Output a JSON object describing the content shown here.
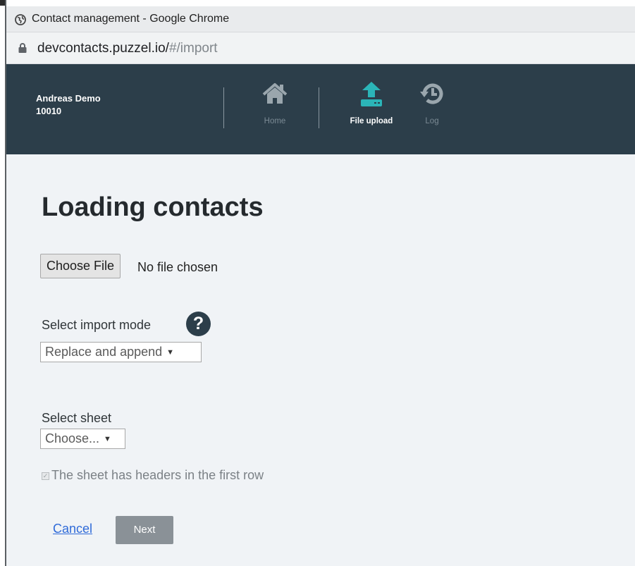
{
  "browser": {
    "window_title": "Contact management - Google Chrome",
    "url_host": "devcontacts.puzzel.io/",
    "url_path": "#/import"
  },
  "header": {
    "user_name": "Andreas Demo",
    "user_id": "10010",
    "nav": [
      {
        "label": "Home",
        "icon": "home-icon",
        "active": false
      },
      {
        "label": "File upload",
        "icon": "upload-icon",
        "active": true
      },
      {
        "label": "Log",
        "icon": "history-icon",
        "active": false
      }
    ]
  },
  "main": {
    "title": "Loading contacts",
    "file_input": {
      "button_label": "Choose File",
      "status": "No file chosen"
    },
    "import_mode": {
      "label": "Select import mode",
      "help": "?",
      "selected": "Replace and append"
    },
    "sheet": {
      "label": "Select sheet",
      "selected": "Choose..."
    },
    "headers_checkbox": {
      "label": "The sheet has headers in the first row",
      "checked": true
    },
    "actions": {
      "cancel": "Cancel",
      "next": "Next"
    }
  },
  "colors": {
    "header_bg": "#2c3e4a",
    "accent": "#2bb5b8",
    "link": "#2f6ad8",
    "disabled_button": "#8a9197"
  }
}
